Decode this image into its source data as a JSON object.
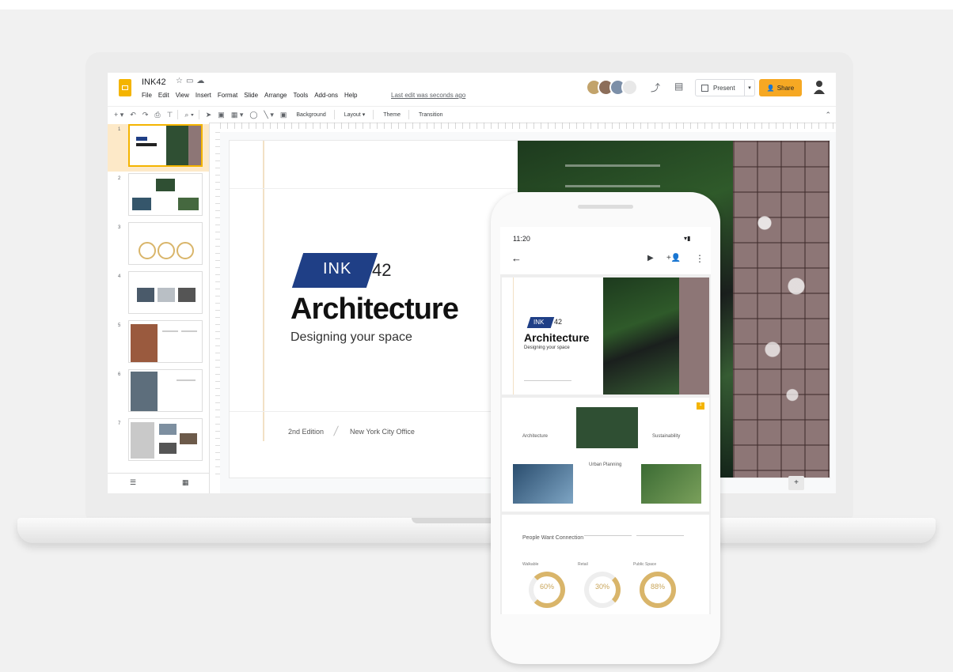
{
  "app": {
    "doc_title": "INK42",
    "menu": [
      "File",
      "Edit",
      "View",
      "Insert",
      "Format",
      "Slide",
      "Arrange",
      "Tools",
      "Add-ons",
      "Help"
    ],
    "last_edit": "Last edit was seconds ago",
    "present_label": "Present",
    "share_label": "Share",
    "collaborator_colors": [
      "#c2a36b",
      "#8c6e5a",
      "#7c8fa8",
      "#e8e8e8"
    ]
  },
  "toolbar": {
    "background_label": "Background",
    "layout_label": "Layout",
    "theme_label": "Theme",
    "transition_label": "Transition"
  },
  "filmstrip": {
    "slide_numbers": [
      "1",
      "2",
      "3",
      "4",
      "5",
      "6",
      "7"
    ]
  },
  "slide": {
    "tag": "INK",
    "number": "42",
    "title": "Architecture",
    "subtitle": "Designing your space",
    "edition": "2nd Edition",
    "office": "New York City Office"
  },
  "phone": {
    "time": "11:20",
    "mini_slide": {
      "tag": "INK",
      "number": "42",
      "title": "Architecture",
      "subtitle": "Designing your space"
    },
    "slide2": {
      "col1": "Architecture",
      "col2": "Urban Planning",
      "col3": "Sustainability",
      "badge": "1"
    },
    "slide3": {
      "heading": "People Want Connection",
      "stats": [
        {
          "label": "Walkable",
          "value": "60%"
        },
        {
          "label": "Retail",
          "value": "30%"
        },
        {
          "label": "Public Space",
          "value": "88%"
        }
      ]
    }
  },
  "colors": {
    "brand_blue": "#1f3f86",
    "accent_yellow": "#f4b400",
    "share_orange": "#f6a823",
    "ring_gold": "#d9b56a"
  },
  "icons": [
    "star-icon",
    "folder-icon",
    "cloud-icon",
    "trend-icon",
    "comment-icon",
    "present-icon",
    "person-icon",
    "account-icon",
    "undo-icon",
    "redo-icon",
    "print-icon",
    "zoom-icon",
    "cursor-icon",
    "back-arrow-icon",
    "play-icon",
    "add-person-icon",
    "more-icon"
  ]
}
